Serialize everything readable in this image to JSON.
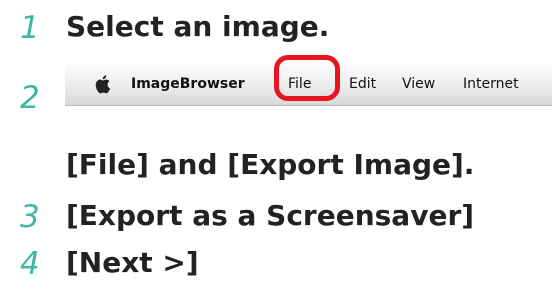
{
  "steps": [
    {
      "number": "1",
      "text": "Select an image."
    },
    {
      "number": "2",
      "text": "[File] and [Export Image]."
    },
    {
      "number": "3",
      "text": "[Export as a Screensaver]"
    },
    {
      "number": "4",
      "text": "[Next >]"
    }
  ],
  "menubar": {
    "apple_icon": "apple-icon",
    "app_name": "ImageBrowser",
    "items": [
      "File",
      "Edit",
      "View",
      "Internet"
    ]
  },
  "colors": {
    "step_number": "#3cb8a4",
    "step_text": "#222222",
    "highlight": "#e8141e"
  }
}
